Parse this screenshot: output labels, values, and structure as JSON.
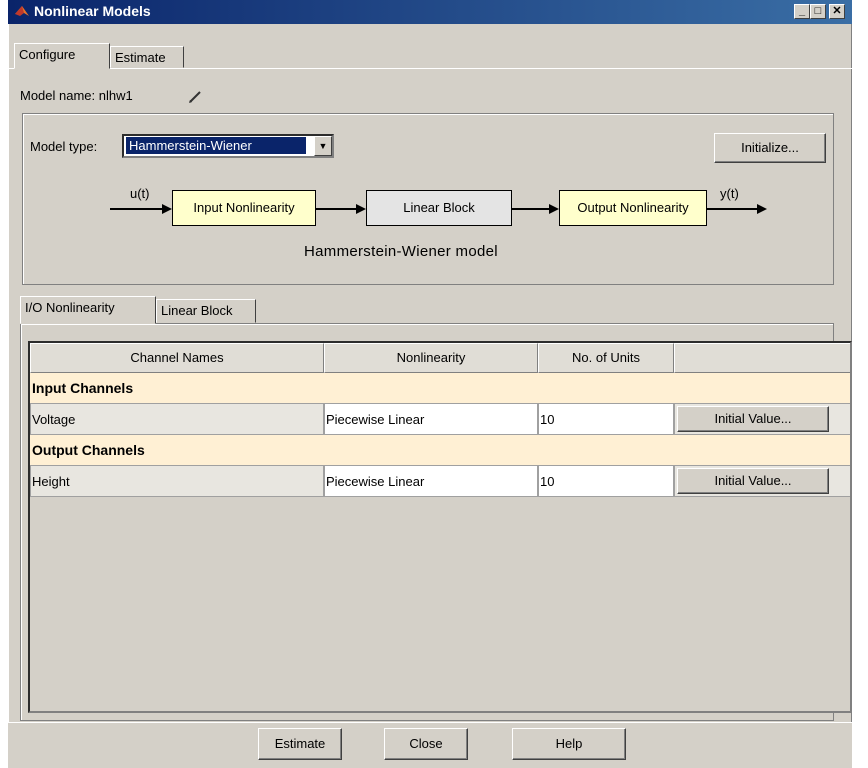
{
  "window": {
    "title": "Nonlinear Models",
    "minimize_glyph": "_",
    "maximize_glyph": "□",
    "close_glyph": "✕"
  },
  "tabs": [
    {
      "label": "Configure",
      "active": true
    },
    {
      "label": "Estimate",
      "active": false
    }
  ],
  "model": {
    "name_label": "Model name: nlhw1",
    "type_label": "Model type:",
    "type_value": "Hammerstein-Wiener",
    "initialize_label": "Initialize..."
  },
  "diagram": {
    "input_signal": "u(t)",
    "output_signal": "y(t)",
    "blocks": [
      "Input Nonlinearity",
      "Linear Block",
      "Output Nonlinearity"
    ],
    "caption": "Hammerstein-Wiener model"
  },
  "sub_tabs": [
    {
      "label": "I/O Nonlinearity",
      "active": true
    },
    {
      "label": "Linear Block",
      "active": false
    }
  ],
  "table": {
    "headers": [
      "Channel Names",
      "Nonlinearity",
      "No. of Units",
      ""
    ],
    "sections": [
      {
        "title": "Input Channels",
        "rows": [
          {
            "name": "Voltage",
            "nonlinearity": "Piecewise Linear",
            "units": "10",
            "button": "Initial Value..."
          }
        ]
      },
      {
        "title": "Output Channels",
        "rows": [
          {
            "name": "Height",
            "nonlinearity": "Piecewise Linear",
            "units": "10",
            "button": "Initial Value..."
          }
        ]
      }
    ]
  },
  "footer": {
    "estimate_label": "Estimate",
    "close_label": "Close",
    "help_label": "Help"
  }
}
